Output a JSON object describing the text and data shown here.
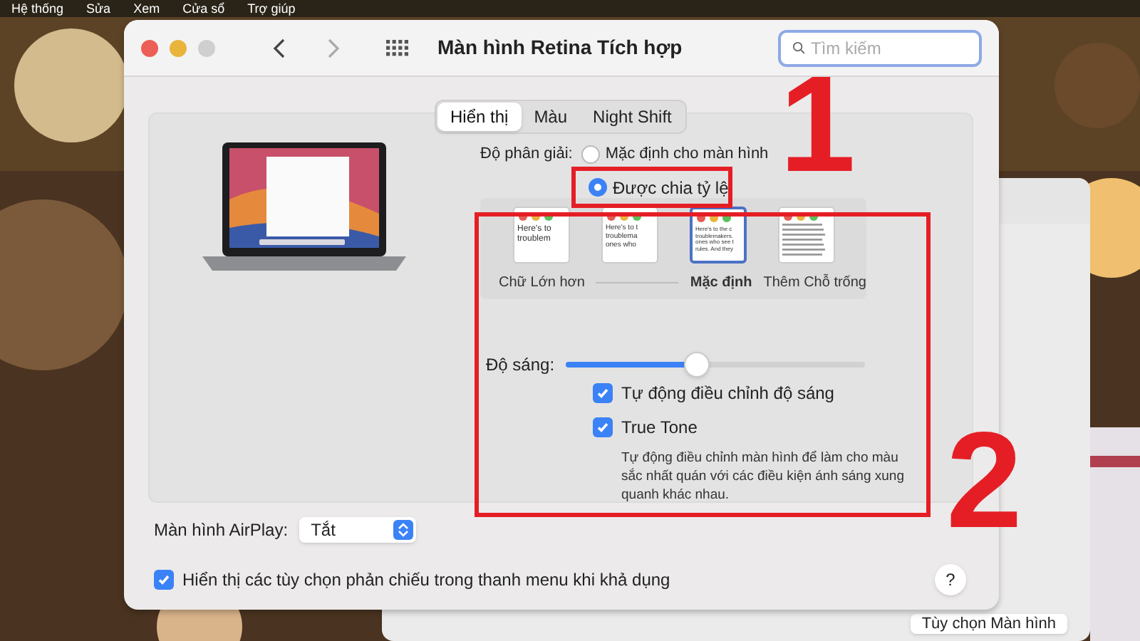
{
  "menu_bar": [
    "Hệ thống",
    "Sửa",
    "Xem",
    "Cửa sổ",
    "Trợ giúp"
  ],
  "window": {
    "title": "Màn hình Retina Tích hợp",
    "search": {
      "placeholder": "Tìm kiếm"
    }
  },
  "tabs": [
    {
      "label": "Hiển thị",
      "selected": true
    },
    {
      "label": "Màu",
      "selected": false
    },
    {
      "label": "Night Shift",
      "selected": false
    }
  ],
  "resolution": {
    "label": "Độ phân giải:",
    "options": [
      {
        "label": "Mặc định cho màn hình",
        "selected": false
      },
      {
        "label": "Được chia tỷ lệ",
        "selected": true
      }
    ]
  },
  "scale_thumbnails": [
    {
      "lines": [
        "Here's to",
        "troublem"
      ],
      "selected": false
    },
    {
      "lines": [
        "Here's to t",
        "troublema",
        "ones who"
      ],
      "selected": false
    },
    {
      "lines": [
        "Here's to the c",
        "troublemakers.",
        "ones who see t",
        "rules. And they"
      ],
      "selected": true
    },
    {
      "selected": false
    }
  ],
  "scale_labels": [
    {
      "label": "Chữ Lớn hơn",
      "selected": false
    },
    {
      "label": "Mặc định",
      "selected": true
    },
    {
      "label": "Thêm Chỗ trống",
      "selected": false
    }
  ],
  "brightness": {
    "label": "Độ sáng:",
    "level": 0.44
  },
  "options": [
    {
      "label": "Tự động điều chỉnh độ sáng",
      "checked": true
    },
    {
      "label": "True Tone",
      "checked": true
    }
  ],
  "true_tone_description": "Tự động điều chỉnh màn hình để làm cho màu sắc nhất quán với các điều kiện ánh sáng xung quanh khác nhau.",
  "airplay": {
    "label": "Màn hình AirPlay:",
    "value": "Tắt"
  },
  "mirror_option": {
    "label": "Hiển thị các tùy chọn phản chiếu trong thanh menu khi khả dụng",
    "checked": true
  },
  "help": "?",
  "background_window": {
    "button": "Tùy chọn Màn hình"
  },
  "annotations": [
    "1",
    "2"
  ]
}
